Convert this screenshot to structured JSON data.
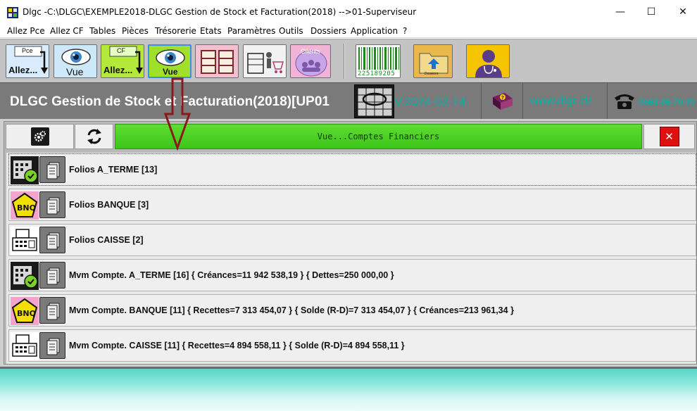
{
  "window": {
    "title": "Dlgc -C:\\DLGC\\EXEMPLE2018-DLGC Gestion de Stock et Facturation(2018) -->01-Superviseur",
    "minimize": "—",
    "maximize": "☐",
    "close": "✕"
  },
  "menu": [
    "Allez Pce",
    "Allez CF",
    "Tables",
    "Pièces",
    "Trésorerie",
    "Etats",
    "Paramètres",
    "Outils",
    "Dossiers",
    "Application",
    "?"
  ],
  "toolbar": {
    "btn_allez_pce_top": "Pce",
    "btn_allez_pce": "Allez...",
    "btn_vue": "Vue",
    "btn_allez_cf_top": "CF",
    "btn_allez_cf": "Allez...",
    "btn_vue2": "Vue",
    "btn_clients": "Clients",
    "barcode_digits": "225189205",
    "dossiers": "Dossiers"
  },
  "banner": {
    "title": "DLGC Gestion de Stock et Facturation(2018)[UP01",
    "version": "V.2024-02-14",
    "website": "www.dlgc.dz",
    "phone": "0663-05-70-70"
  },
  "panel": {
    "header": "Vue...Comptes Financiers",
    "close": "✕"
  },
  "rows": [
    {
      "label": "Folios A_TERME [13]",
      "icon": "calendar-clock-icon"
    },
    {
      "label": "Folios BANQUE [3]",
      "icon": "bnq-icon"
    },
    {
      "label": "Folios CAISSE [2]",
      "icon": "cash-register-icon"
    },
    {
      "label": "Mvm Compte. A_TERME [16]  { Créances=11  942  538,19 }     { Dettes=250  000,00 }",
      "icon": "calendar-clock-icon"
    },
    {
      "label": "Mvm Compte. BANQUE [11]  { Recettes=7  313  454,07 }     { Solde (R-D)=7  313  454,07 }     { Créances=213  961,34 }",
      "icon": "bnq-icon"
    },
    {
      "label": "Mvm Compte. CAISSE [11]  { Recettes=4  894  558,11 }     { Solde (R-D)=4  894  558,11 }",
      "icon": "cash-register-icon"
    }
  ],
  "colors": {
    "accent_green": "#3cc61c",
    "banner_text": "#00b5a5",
    "banner_bg": "#7a7a7a"
  }
}
